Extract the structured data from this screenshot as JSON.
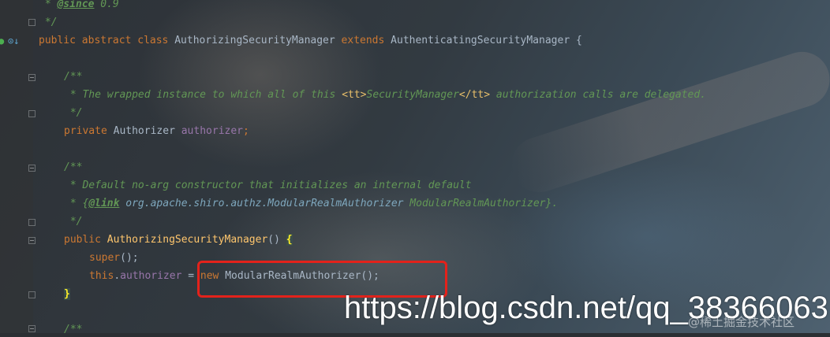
{
  "gutter": {
    "icons": [
      "override-marker-icon",
      "implemented-marker-icon"
    ]
  },
  "code": {
    "l1": {
      "prefix": " * ",
      "tag": "@since",
      "rest": " 0.9"
    },
    "l2": " */",
    "l3": {
      "k1": "public",
      "k2": "abstract",
      "k3": "class",
      "name": "AuthorizingSecurityManager",
      "k4": "extends",
      "parent": "AuthenticatingSecurityManager",
      "brace": " {"
    },
    "l4": "/**",
    "l5": {
      "a": " * The wrapped instance to which all of this ",
      "t1": "<tt>",
      "b": "SecurityManager",
      "t2": "</tt>",
      "c": " authorization calls are delegated."
    },
    "l6": " */",
    "l7": {
      "k": "private",
      "type": "Authorizer",
      "field": "authorizer",
      "end": ";"
    },
    "l8": "/**",
    "l9": " * Default no-arg constructor that initializes an internal default",
    "l10": {
      "a": " * {",
      "link": "@link",
      "fqcn": " org.apache.shiro.authz.ModularRealmAuthorizer",
      "b": " ModularRealmAuthorizer}."
    },
    "l11": " */",
    "l12": {
      "k": "public",
      "name": "AuthorizingSecurityManager",
      "parens": "() ",
      "brace": "{"
    },
    "l13": {
      "k": "super",
      "end": "();"
    },
    "l14": {
      "k": "this",
      "dot": ".",
      "field": "authorizer",
      "eq": " = ",
      "new": "new",
      "rest": " ModularRealmAuthorizer();"
    },
    "l15": "}",
    "l16": "/**"
  },
  "watermark": {
    "url": "https://blog.csdn.net/qq_38366063",
    "small": "@稀土掘金技术社区"
  },
  "colors": {
    "keyword": "#cc7832",
    "comment": "#629755",
    "field": "#9876aa",
    "highlight_box": "#e3221b"
  }
}
